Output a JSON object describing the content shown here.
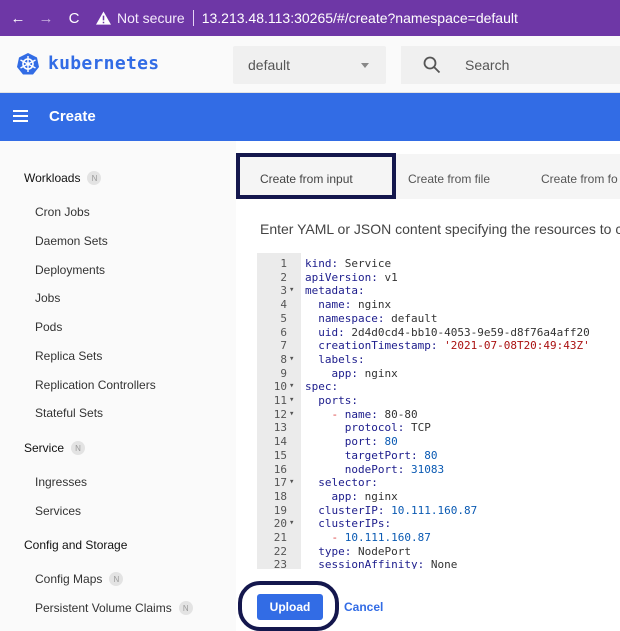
{
  "browser": {
    "not_secure": "Not secure",
    "url": "13.213.48.113:30265/#/create?namespace=default"
  },
  "header": {
    "brand": "kubernetes",
    "namespace": "default",
    "search_placeholder": "Search"
  },
  "toolbar": {
    "title": "Create"
  },
  "sidebar": {
    "sections": [
      {
        "label": "Workloads",
        "badge": "N"
      },
      {
        "label": "Service",
        "badge": "N"
      },
      {
        "label": "Config and Storage",
        "badge": ""
      }
    ],
    "workloads": [
      "Cron Jobs",
      "Daemon Sets",
      "Deployments",
      "Jobs",
      "Pods",
      "Replica Sets",
      "Replication Controllers",
      "Stateful Sets"
    ],
    "service": [
      "Ingresses",
      "Services"
    ],
    "config": [
      {
        "label": "Config Maps",
        "badge": "N"
      },
      {
        "label": "Persistent Volume Claims",
        "badge": "N"
      }
    ]
  },
  "tabs": [
    "Create from input",
    "Create from file",
    "Create from fo"
  ],
  "description": "Enter YAML or JSON content specifying the resources to c",
  "editor": {
    "lines": [
      {
        "n": "1",
        "fold": "",
        "html": "<span class='k'>kind:</span> <span class='v'>Service</span>"
      },
      {
        "n": "2",
        "fold": "",
        "html": "<span class='k'>apiVersion:</span> <span class='v'>v1</span>"
      },
      {
        "n": "3",
        "fold": "▾",
        "html": "<span class='k'>metadata:</span>"
      },
      {
        "n": "4",
        "fold": "",
        "html": "  <span class='k'>name:</span> <span class='v'>nginx</span>"
      },
      {
        "n": "5",
        "fold": "",
        "html": "  <span class='k'>namespace:</span> <span class='v'>default</span>"
      },
      {
        "n": "6",
        "fold": "",
        "html": "  <span class='k'>uid:</span> <span class='v'>2d4d0cd4-bb10-4053-9e59-d8f76a4aff20</span>"
      },
      {
        "n": "7",
        "fold": "",
        "html": "  <span class='k'>creationTimestamp:</span> <span class='s'>'2021-07-08T20:49:43Z'</span>"
      },
      {
        "n": "8",
        "fold": "▾",
        "html": "  <span class='k'>labels:</span>"
      },
      {
        "n": "9",
        "fold": "",
        "html": "    <span class='k'>app:</span> <span class='v'>nginx</span>"
      },
      {
        "n": "10",
        "fold": "▾",
        "html": "<span class='k'>spec:</span>"
      },
      {
        "n": "11",
        "fold": "▾",
        "html": "  <span class='k'>ports:</span>"
      },
      {
        "n": "12",
        "fold": "▾",
        "html": "    <span class='d'>-</span> <span class='k'>name:</span> <span class='v'>80-80</span>"
      },
      {
        "n": "13",
        "fold": "",
        "html": "      <span class='k'>protocol:</span> <span class='v'>TCP</span>"
      },
      {
        "n": "14",
        "fold": "",
        "html": "      <span class='k'>port:</span> <span class='n'>80</span>"
      },
      {
        "n": "15",
        "fold": "",
        "html": "      <span class='k'>targetPort:</span> <span class='n'>80</span>"
      },
      {
        "n": "16",
        "fold": "",
        "html": "      <span class='k'>nodePort:</span> <span class='n'>31083</span>"
      },
      {
        "n": "17",
        "fold": "▾",
        "html": "  <span class='k'>selector:</span>"
      },
      {
        "n": "18",
        "fold": "",
        "html": "    <span class='k'>app:</span> <span class='v'>nginx</span>"
      },
      {
        "n": "19",
        "fold": "",
        "html": "  <span class='k'>clusterIP:</span> <span class='n'>10.111.160.87</span>"
      },
      {
        "n": "20",
        "fold": "▾",
        "html": "  <span class='k'>clusterIPs:</span>"
      },
      {
        "n": "21",
        "fold": "",
        "html": "    <span class='d'>-</span> <span class='n'>10.111.160.87</span>"
      },
      {
        "n": "22",
        "fold": "",
        "html": "  <span class='k'>type:</span> <span class='v'>NodePort</span>"
      },
      {
        "n": "23",
        "fold": "",
        "html": "  <span class='k'>sessionAffinity:</span> <span class='v'>None</span>"
      }
    ]
  },
  "actions": {
    "upload": "Upload",
    "cancel": "Cancel"
  },
  "colors": {
    "chrome": "#6e37a6",
    "primary": "#326ce5",
    "highlight": "#14174d"
  }
}
